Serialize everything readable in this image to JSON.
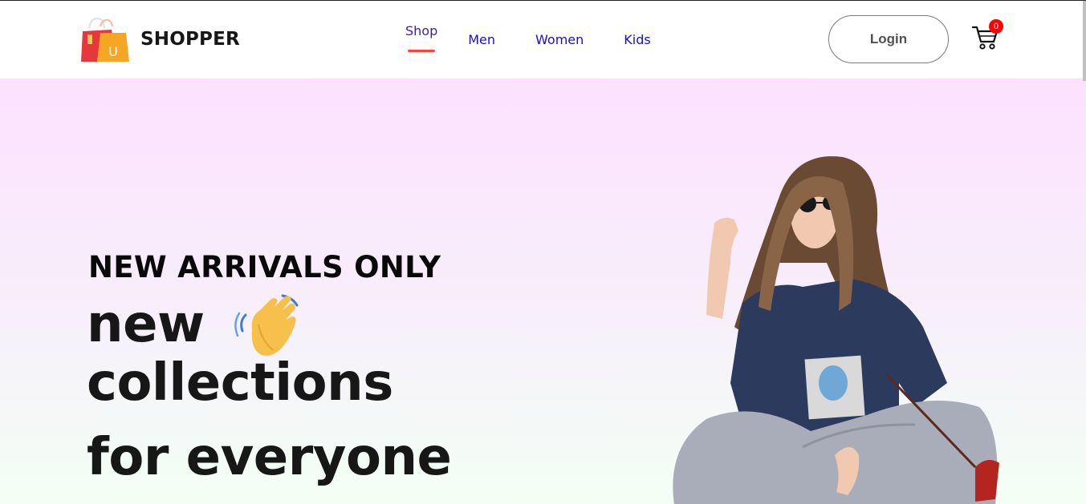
{
  "brand": {
    "name": "SHOPPER",
    "icon": "shopping-bag-icon"
  },
  "nav": {
    "items": [
      {
        "label": "Shop",
        "active": true
      },
      {
        "label": "Men",
        "active": false
      },
      {
        "label": "Women",
        "active": false
      },
      {
        "label": "Kids",
        "active": false
      }
    ]
  },
  "header": {
    "login_label": "Login",
    "cart_icon": "cart-icon",
    "cart_count": "0"
  },
  "hero": {
    "tagline": "NEW ARRIVALS ONLY",
    "line1": "new",
    "line2": "collections",
    "line3": "for everyone",
    "emoji_icon": "waving-hand-icon",
    "image": "model-photo"
  },
  "colors": {
    "nav_link": "#1a0dd4",
    "nav_active": "#4b1a9e",
    "active_underline": "#ff4141",
    "cart_badge": "#ff0000",
    "hero_gradient_top": "#fde1ff",
    "hero_gradient_bottom": "#f3fff5"
  }
}
